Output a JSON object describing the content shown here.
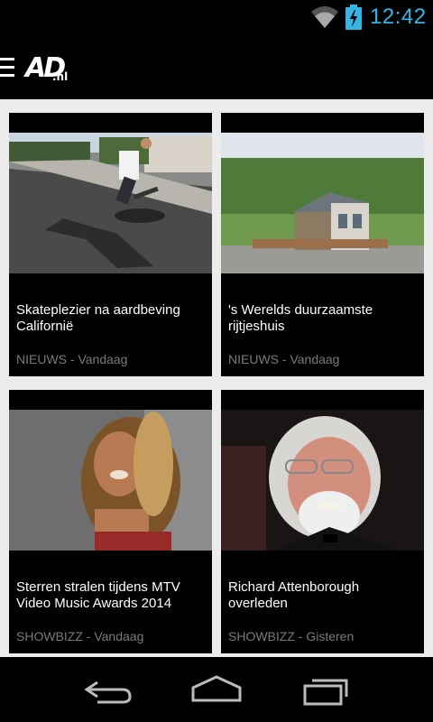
{
  "status_bar": {
    "time": "12:42",
    "icons": [
      "wifi-icon",
      "battery-charging-icon"
    ],
    "accent_color": "#33b5e5"
  },
  "action_bar": {
    "logo_main": "AD",
    "logo_suffix": ".nl",
    "icons": [
      "menu-icon"
    ]
  },
  "articles": [
    {
      "title": "Skateplezier na aardbeving Californië",
      "category": "NIEUWS",
      "separator": " - ",
      "date": "Vandaag"
    },
    {
      "title": "'s Werelds duurzaamste rijtjeshuis",
      "category": "NIEUWS",
      "separator": " - ",
      "date": "Vandaag"
    },
    {
      "title": "Sterren stralen tijdens MTV Video Music Awards 2014",
      "category": "SHOWBIZZ",
      "separator": " - ",
      "date": "Vandaag"
    },
    {
      "title": "Richard Attenborough overleden",
      "category": "SHOWBIZZ",
      "separator": " - ",
      "date": "Gisteren"
    }
  ],
  "nav_bar": {
    "icons": [
      "back-icon",
      "home-icon",
      "recents-icon"
    ]
  },
  "colors": {
    "background": "#ececec",
    "card": "#000000",
    "meta_text": "#7a7a7a"
  }
}
